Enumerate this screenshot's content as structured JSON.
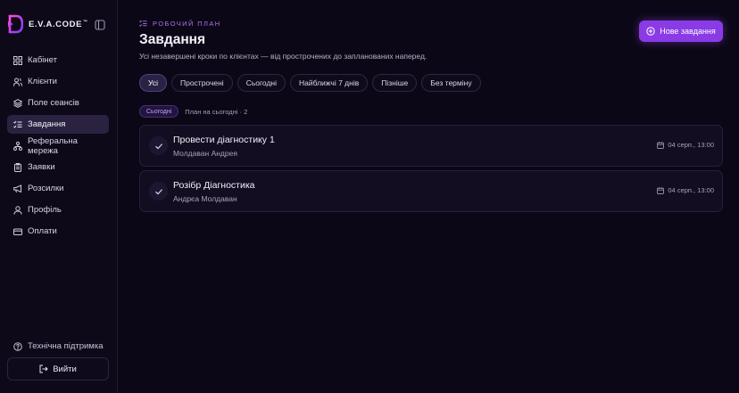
{
  "brand": {
    "name": "E.V.A.CODE",
    "trademark": "™"
  },
  "sidebar": {
    "items": [
      {
        "label": "Кабінет",
        "icon": "dashboard-icon",
        "active": false
      },
      {
        "label": "Клієнти",
        "icon": "users-icon",
        "active": false
      },
      {
        "label": "Поле сеансів",
        "icon": "layers-icon",
        "active": false
      },
      {
        "label": "Завдання",
        "icon": "tasks-icon",
        "active": true
      },
      {
        "label": "Реферальна мережа",
        "icon": "network-icon",
        "active": false
      },
      {
        "label": "Заявки",
        "icon": "clipboard-icon",
        "active": false
      },
      {
        "label": "Розсилки",
        "icon": "megaphone-icon",
        "active": false
      },
      {
        "label": "Профіль",
        "icon": "user-icon",
        "active": false
      },
      {
        "label": "Оплати",
        "icon": "credit-card-icon",
        "active": false
      }
    ],
    "support_label": "Технічна підтримка",
    "logout_label": "Вийти"
  },
  "header": {
    "eyebrow": "РОБОЧИЙ ПЛАН",
    "title": "Завдання",
    "subtitle": "Усі незавершені кроки по клієнтах — від прострочених до запланованих наперед.",
    "new_task_label": "Нове завдання"
  },
  "filters": [
    {
      "label": "Усі",
      "active": true
    },
    {
      "label": "Прострочені",
      "active": false
    },
    {
      "label": "Сьогодні",
      "active": false
    },
    {
      "label": "Найближчі 7 днів",
      "active": false
    },
    {
      "label": "Пізніше",
      "active": false
    },
    {
      "label": "Без терміну",
      "active": false
    }
  ],
  "section": {
    "badge": "Сьогодні",
    "label": "План на сьогодні · 2"
  },
  "tasks": [
    {
      "title": "Провести діагностику 1",
      "client": "Молдаван Андрея",
      "date": "04 серп., 13:00"
    },
    {
      "title": "Розібр Діагностика",
      "client": "Андрєа Молдаван",
      "date": "04 серп., 13:00"
    }
  ],
  "colors": {
    "accent": "#8a3be6",
    "accent_text": "#a874f0",
    "background": "#0c0716",
    "card": "#130d21"
  }
}
